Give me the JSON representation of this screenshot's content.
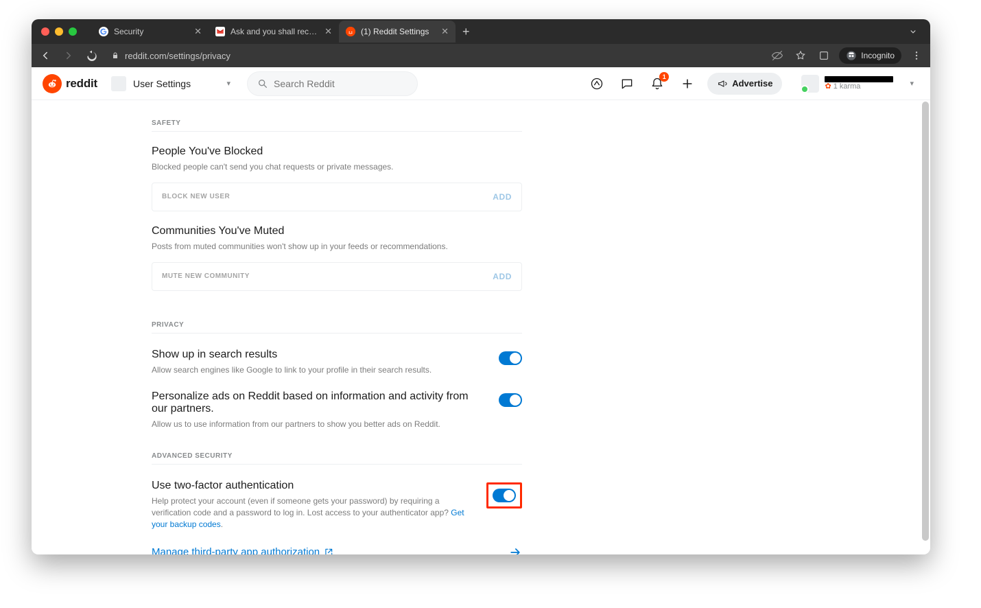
{
  "browser": {
    "tabs": [
      {
        "label": "Security",
        "favicon": "#ffffff",
        "favicon_svg": "google"
      },
      {
        "label": "Ask and you shall receive... a |",
        "favicon": "#ffffff",
        "favicon_svg": "gmail"
      },
      {
        "label": "(1) Reddit Settings",
        "favicon": "#ff4500",
        "favicon_svg": "reddit"
      }
    ],
    "url": "reddit.com/settings/privacy",
    "incognito_label": "Incognito"
  },
  "header": {
    "logo_text": "reddit",
    "selector_label": "User Settings",
    "search_placeholder": "Search Reddit",
    "advertise_label": "Advertise",
    "notification_count": "1",
    "user": {
      "karma_label": "1 karma"
    }
  },
  "sections": {
    "safety": {
      "label": "SAFETY",
      "blocked": {
        "title": "People You've Blocked",
        "desc": "Blocked people can't send you chat requests or private messages.",
        "placeholder": "BLOCK NEW USER",
        "button": "ADD"
      },
      "muted": {
        "title": "Communities You've Muted",
        "desc": "Posts from muted communities won't show up in your feeds or recommendations.",
        "placeholder": "MUTE NEW COMMUNITY",
        "button": "ADD"
      }
    },
    "privacy": {
      "label": "PRIVACY",
      "search": {
        "title": "Show up in search results",
        "desc": "Allow search engines like Google to link to your profile in their search results.",
        "on": true
      },
      "ads": {
        "title": "Personalize ads on Reddit based on information and activity from our partners.",
        "desc": "Allow us to use information from our partners to show you better ads on Reddit.",
        "on": true
      }
    },
    "advsec": {
      "label": "ADVANCED SECURITY",
      "twofa": {
        "title": "Use two-factor authentication",
        "desc_a": "Help protect your account (even if someone gets your password) by requiring a verification code and a password to log in. Lost access to your authenticator app? ",
        "desc_link": "Get your backup codes",
        "on": true
      },
      "thirdparty": {
        "label": "Manage third-party app authorization"
      }
    }
  }
}
